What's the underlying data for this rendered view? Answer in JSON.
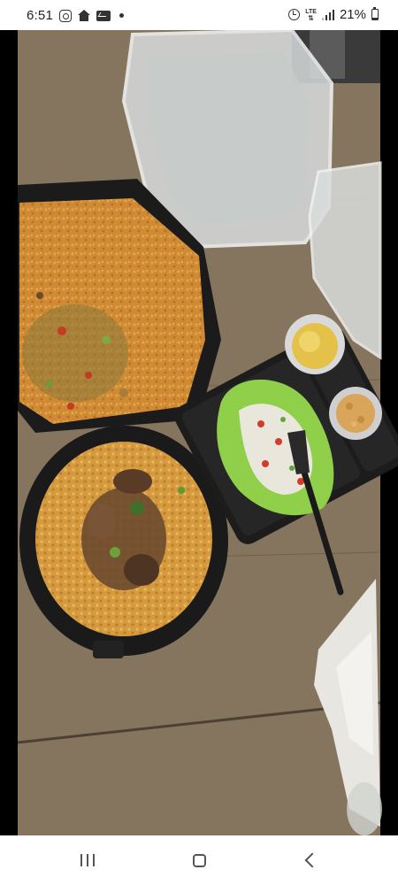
{
  "status_bar": {
    "time": "6:51",
    "network_label": "LTE",
    "battery_text": "21%",
    "battery_level": 0.21,
    "icons": [
      "instagram-icon",
      "home-icon",
      "mail-icon",
      "dot-icon",
      "alarm-icon",
      "lte-icon",
      "signal-icon",
      "battery-icon"
    ]
  },
  "photo": {
    "icons": [
      "rice-tray",
      "rice-bowl",
      "lettuce-wrap",
      "fork",
      "sauce-cup",
      "chickpea-cup",
      "napkin",
      "clear-lid"
    ]
  },
  "nav_bar": {
    "icons": [
      "recents-icon",
      "home-icon",
      "back-icon"
    ]
  },
  "colors": {
    "table_wood": "#8a7a63",
    "rice": "#d0903a",
    "lettuce": "#8fcf4a",
    "container": "#1b1b1b"
  }
}
